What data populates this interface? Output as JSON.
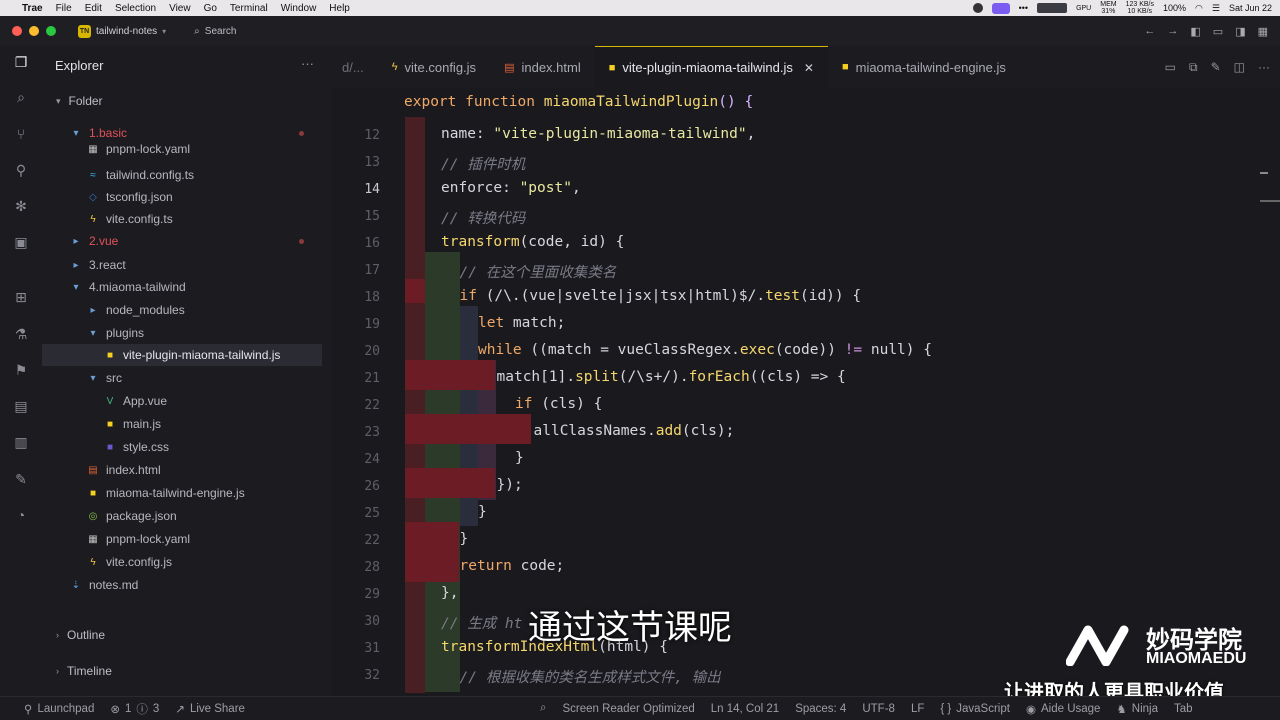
{
  "menubar": {
    "app_name": "Trae",
    "items": [
      "File",
      "Edit",
      "Selection",
      "View",
      "Go",
      "Terminal",
      "Window",
      "Help"
    ],
    "gpu_label": "GPU",
    "mem_label": "MEM",
    "mem_value": "31%",
    "net_up": "123 KB/s",
    "net_down": "10 KB/s",
    "battery": "100%",
    "date": "Sat Jun 22"
  },
  "titlebar": {
    "project_badge": "TN",
    "project_name": "tailwind-notes",
    "search_label": "Search"
  },
  "explorer": {
    "title": "Explorer",
    "folder_label": "Folder",
    "tree": [
      {
        "label": "1.basic",
        "kind": "folder-open",
        "color": "#e0525a",
        "indent": 0,
        "modified": true
      },
      {
        "label": "pnpm-lock.yaml",
        "kind": "yaml",
        "indent": 1
      },
      {
        "label": "tailwind.config.ts",
        "kind": "tailwind",
        "indent": 1
      },
      {
        "label": "tsconfig.json",
        "kind": "tsconfig",
        "indent": 1
      },
      {
        "label": "vite.config.ts",
        "kind": "vite",
        "indent": 1
      },
      {
        "label": "2.vue",
        "kind": "folder",
        "color": "#e0525a",
        "indent": 0,
        "modified": true
      },
      {
        "label": "3.react",
        "kind": "folder",
        "indent": 0
      },
      {
        "label": "4.miaoma-tailwind",
        "kind": "folder-open",
        "indent": 0
      },
      {
        "label": "node_modules",
        "kind": "folder",
        "indent": 1
      },
      {
        "label": "plugins",
        "kind": "folder-open",
        "indent": 1
      },
      {
        "label": "vite-plugin-miaoma-tailwind.js",
        "kind": "js",
        "indent": 2,
        "selected": true
      },
      {
        "label": "src",
        "kind": "folder-open",
        "indent": 1
      },
      {
        "label": "App.vue",
        "kind": "vue",
        "indent": 2
      },
      {
        "label": "main.js",
        "kind": "js",
        "indent": 2
      },
      {
        "label": "style.css",
        "kind": "css",
        "indent": 2
      },
      {
        "label": "index.html",
        "kind": "html",
        "indent": 1
      },
      {
        "label": "miaoma-tailwind-engine.js",
        "kind": "js",
        "indent": 1
      },
      {
        "label": "package.json",
        "kind": "json",
        "indent": 1
      },
      {
        "label": "pnpm-lock.yaml",
        "kind": "yaml",
        "indent": 1
      },
      {
        "label": "vite.config.js",
        "kind": "vite",
        "indent": 1
      },
      {
        "label": "notes.md",
        "kind": "md",
        "indent": 0
      }
    ],
    "outline_label": "Outline",
    "timeline_label": "Timeline"
  },
  "tabs": [
    {
      "label": "d/...",
      "kind": "partial"
    },
    {
      "label": "vite.config.js",
      "kind": "vite"
    },
    {
      "label": "index.html",
      "kind": "html"
    },
    {
      "label": "vite-plugin-miaoma-tailwind.js",
      "kind": "js",
      "active": true
    },
    {
      "label": "miaoma-tailwind-engine.js",
      "kind": "js"
    }
  ],
  "editor": {
    "header_line": "export function miaomaTailwindPlugin() {",
    "line_numbers": [
      "12",
      "13",
      "14",
      "15",
      "16",
      "17",
      "18",
      "19",
      "20",
      "21",
      "22",
      "23",
      "24",
      "26",
      "25",
      "22",
      "28",
      "29",
      "30",
      "31",
      "32"
    ],
    "current_line": "14",
    "lines": [
      "name: \"vite-plugin-miaoma-tailwind\",",
      "// 插件时机",
      "enforce: \"post\",",
      "// 转换代码",
      "transform(code, id) {",
      "// 在这个里面收集类名",
      "if (/\\.(vue|svelte|jsx|tsx|html)$/.test(id)) {",
      "let match;",
      "while ((match = vueClassRegex.exec(code)) != null) {",
      "match[1].split(/\\s+/).forEach((cls) => {",
      "if (cls) {",
      "allClassNames.add(cls);",
      "}",
      "});",
      "}",
      "}",
      "return code;",
      "},",
      "// 生成 ht",
      "transformIndexHtml(html) {",
      "// 根据收集的类名生成样式文件, 输出"
    ]
  },
  "subtitle": "通过这节课呢",
  "watermark": {
    "brand_cn": "妙码学院",
    "brand_en": "MIAOMAEDU",
    "slogan": "让进取的人更具职业价值"
  },
  "statusbar": {
    "launchpad": "Launchpad",
    "errors": "1",
    "warnings": "3",
    "live_share": "Live Share",
    "screen_reader": "Screen Reader Optimized",
    "position": "Ln 14, Col 21",
    "spaces": "Spaces: 4",
    "encoding": "UTF-8",
    "eol": "LF",
    "language": "JavaScript",
    "aide": "Aide Usage",
    "ninja": "Ninja",
    "tab": "Tab"
  },
  "colors": {
    "accent": "#d7b600",
    "error_folder": "#e0525a",
    "bg_editor": "#1a1a1e",
    "bg_sidebar": "#1c1c20"
  }
}
